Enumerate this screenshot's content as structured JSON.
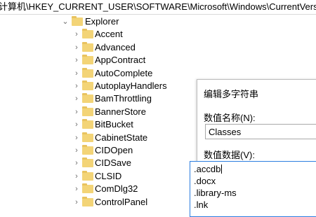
{
  "address_bar": {
    "path": "计算机\\HKEY_CURRENT_USER\\SOFTWARE\\Microsoft\\Windows\\CurrentVersion\\Explor"
  },
  "tree": {
    "parent": "Explorer",
    "children": [
      "Accent",
      "Advanced",
      "AppContract",
      "AutoComplete",
      "AutoplayHandlers",
      "BamThrottling",
      "BannerStore",
      "BitBucket",
      "CabinetState",
      "CIDOpen",
      "CIDSave",
      "CLSID",
      "ComDlg32",
      "ControlPanel"
    ]
  },
  "dialog": {
    "title": "编辑多字符串",
    "value_name_label": "数值名称(N):",
    "value_name": "Classes",
    "value_data_label": "数值数据(V):",
    "value_data_lines": [
      ".accdb",
      ".docx",
      ".library-ms",
      ".lnk"
    ]
  },
  "colors": {
    "folder": "#f3d477",
    "focus_border": "#2b7de0"
  }
}
